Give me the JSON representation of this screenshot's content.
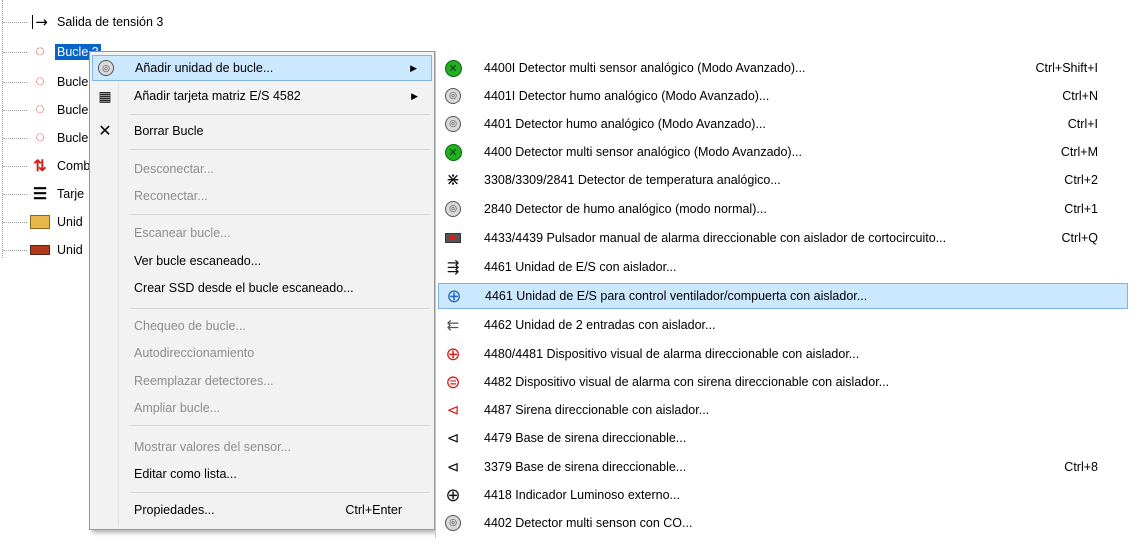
{
  "tree": {
    "items": [
      {
        "label": "Salida de tensión 3",
        "icon": "output-arrow-icon",
        "glyph": "→"
      },
      {
        "label": "Bucle 3",
        "icon": "loop-icon",
        "glyph": "◌",
        "selected": true
      },
      {
        "label": "Bucle",
        "icon": "loop-icon",
        "glyph": "◌"
      },
      {
        "label": "Bucle",
        "icon": "loop-icon",
        "glyph": "◌"
      },
      {
        "label": "Bucle",
        "icon": "loop-icon",
        "glyph": "◌"
      },
      {
        "label": "Comb",
        "icon": "combo-arrows-icon",
        "glyph": "⇅"
      },
      {
        "label": "Tarje",
        "icon": "card-icon",
        "glyph": "☰"
      },
      {
        "label": "Unid",
        "icon": "unit-folder-icon",
        "glyph": "▭"
      },
      {
        "label": "Unid",
        "icon": "unit-bar-icon",
        "glyph": "▬"
      }
    ]
  },
  "context_menu": {
    "items": [
      {
        "label": "Añadir unidad de bucle...",
        "icon": "detector-icon",
        "glyph": "◎",
        "submenu": true,
        "highlight": true
      },
      {
        "label": "Añadir tarjeta matriz E/S 4582",
        "icon": "matrix-card-icon",
        "glyph": "▦",
        "submenu": true
      },
      {
        "label": "Borrar Bucle",
        "icon": "delete-icon",
        "glyph": "✕"
      },
      {
        "label": "Desconectar...",
        "disabled": true
      },
      {
        "label": "Reconectar...",
        "disabled": true
      },
      {
        "label": "Escanear bucle...",
        "disabled": true
      },
      {
        "label": "Ver bucle escaneado..."
      },
      {
        "label": "Crear SSD desde el bucle escaneado..."
      },
      {
        "label": "Chequeo de bucle...",
        "disabled": true
      },
      {
        "label": "Autodireccionamiento",
        "disabled": true
      },
      {
        "label": "Reemplazar detectores...",
        "disabled": true
      },
      {
        "label": "Ampliar bucle...",
        "disabled": true
      },
      {
        "label": "Mostrar valores del sensor...",
        "disabled": true
      },
      {
        "label": "Editar como lista..."
      },
      {
        "label": "Propiedades...",
        "shortcut": "Ctrl+Enter"
      }
    ],
    "submenu_arrow": "▶"
  },
  "submenu": {
    "items": [
      {
        "label": "4400I Detector multi sensor analógico (Modo Avanzado)...",
        "shortcut": "Ctrl+Shift+I",
        "icon": "multi-sensor-green-icon"
      },
      {
        "label": "4401I Detector humo analógico (Modo Avanzado)...",
        "shortcut": "Ctrl+N",
        "icon": "smoke-detector-icon"
      },
      {
        "label": "4401 Detector humo analógico (Modo Avanzado)...",
        "shortcut": "Ctrl+I",
        "icon": "smoke-detector-icon"
      },
      {
        "label": "4400 Detector multi sensor analógico (Modo Avanzado)...",
        "shortcut": "Ctrl+M",
        "icon": "multi-sensor-green-icon"
      },
      {
        "label": "3308/3309/2841 Detector de temperatura analógico...",
        "shortcut": "Ctrl+2",
        "icon": "heat-detector-icon"
      },
      {
        "label": "2840 Detector de humo analógico (modo normal)...",
        "shortcut": "Ctrl+1",
        "icon": "smoke-detector-icon"
      },
      {
        "label": "4433/4439 Pulsador manual de alarma direccionable con aislador de cortocircuito...",
        "shortcut": "Ctrl+Q",
        "icon": "manual-call-point-icon"
      },
      {
        "label": "4461 Unidad de E/S con aislador...",
        "shortcut": "",
        "icon": "io-unit-icon"
      },
      {
        "label": "4461 Unidad de E/S para control ventilador/compuerta con aislador...",
        "shortcut": "",
        "icon": "fan-control-icon",
        "highlight": true
      },
      {
        "label": "4462 Unidad de 2 entradas con aislador...",
        "shortcut": "",
        "icon": "input-unit-icon"
      },
      {
        "label": "4480/4481 Dispositivo visual de alarma direccionable con aislador...",
        "shortcut": "",
        "icon": "visual-alarm-icon"
      },
      {
        "label": "4482 Dispositivo visual de alarma con sirena direccionable con aislador...",
        "shortcut": "",
        "icon": "visual-siren-icon"
      },
      {
        "label": "4487 Sirena direccionable con aislador...",
        "shortcut": "",
        "icon": "siren-red-icon"
      },
      {
        "label": "4479 Base de sirena direccionable...",
        "shortcut": "",
        "icon": "siren-base-icon"
      },
      {
        "label": "3379 Base de sirena direccionable...",
        "shortcut": "Ctrl+8",
        "icon": "siren-base-icon"
      },
      {
        "label": "4418 Indicador Luminoso externo...",
        "shortcut": "",
        "icon": "external-indicator-icon"
      },
      {
        "label": "4402 Detector multi senson con CO...",
        "shortcut": "",
        "icon": "co-detector-icon"
      }
    ]
  },
  "colors": {
    "selection": "#0a64c8",
    "menu_highlight": "#cce8ff",
    "menu_highlight_border": "#7eb4ea",
    "disabled_text": "#8d8d8d"
  }
}
